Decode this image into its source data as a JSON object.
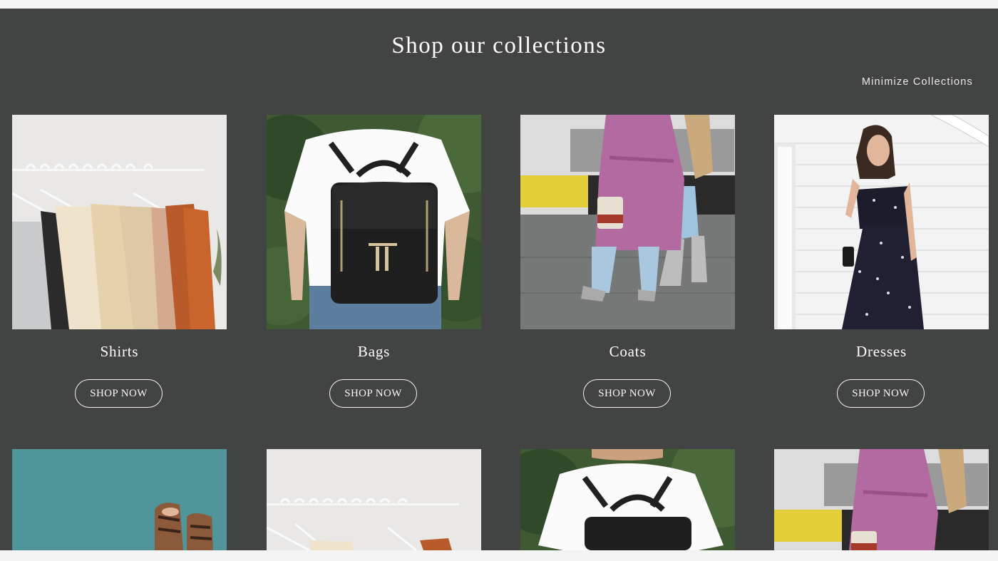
{
  "section": {
    "title": "Shop our collections",
    "minimize_label": "Minimize Collections"
  },
  "collections": [
    {
      "name": "Shirts",
      "button_label": "SHOP NOW",
      "image": "clothes-rack-photo"
    },
    {
      "name": "Bags",
      "button_label": "SHOP NOW",
      "image": "backpack-photo"
    },
    {
      "name": "Coats",
      "button_label": "SHOP NOW",
      "image": "pink-coat-photo"
    },
    {
      "name": "Dresses",
      "button_label": "SHOP NOW",
      "image": "floral-dress-photo"
    }
  ],
  "collections_row2": [
    {
      "image": "sandals-photo"
    },
    {
      "image": "clothes-rack-photo"
    },
    {
      "image": "backpack-photo"
    },
    {
      "image": "pink-coat-photo"
    }
  ],
  "colors": {
    "panel_background": "#424343",
    "page_background": "#f4f4f4",
    "text": "#ffffff"
  }
}
